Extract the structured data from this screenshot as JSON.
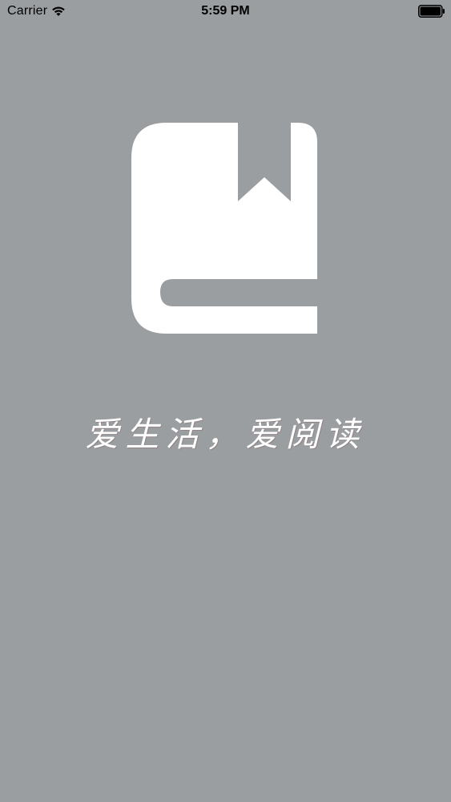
{
  "status_bar": {
    "carrier": "Carrier",
    "time": "5:59 PM",
    "wifi_icon": "wifi-icon",
    "battery_icon": "battery-icon"
  },
  "splash": {
    "logo_icon": "book-bookmark-icon",
    "slogan": "爱生活，爱阅读"
  },
  "colors": {
    "background": "#9a9ea1",
    "logo": "#ffffff",
    "slogan": "#ffffff"
  }
}
